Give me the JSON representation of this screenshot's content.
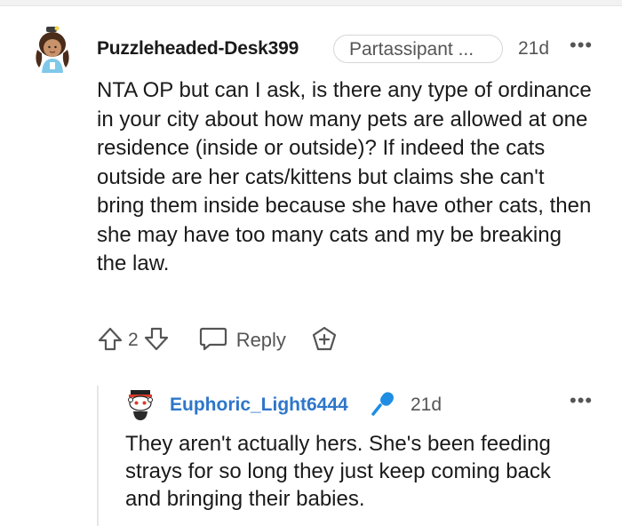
{
  "comment": {
    "username": "Puzzleheaded-Desk399",
    "flair": "Partassipant ...",
    "time": "21d",
    "more": "•••",
    "body": "NTA OP but can I ask, is there any type of ordinance in your city about how many pets are allowed at one residence (inside or outside)? If indeed the cats outside are her cats/kittens but claims she can't bring them inside because she have other cats, then she may have too many cats and my be breaking the law.",
    "votes": "2",
    "reply_label": "Reply",
    "avatar_icon": "cartoon-avatar-icon",
    "upvote_icon": "arrow-up-icon",
    "downvote_icon": "arrow-down-icon",
    "reply_icon": "speech-bubble-icon",
    "award_icon": "award-plus-icon"
  },
  "reply": {
    "username": "Euphoric_Light6444",
    "badge_icon": "microphone-icon",
    "time": "21d",
    "more": "•••",
    "body": "They aren't actually hers. She's been feeding strays for so long they just keep coming back and bringing their babies.",
    "avatar_icon": "snoo-avatar-icon"
  },
  "colors": {
    "username_reply": "#2e76c9",
    "mic": "#1f8de3",
    "muted": "#555555",
    "text": "#1a1a1b"
  }
}
